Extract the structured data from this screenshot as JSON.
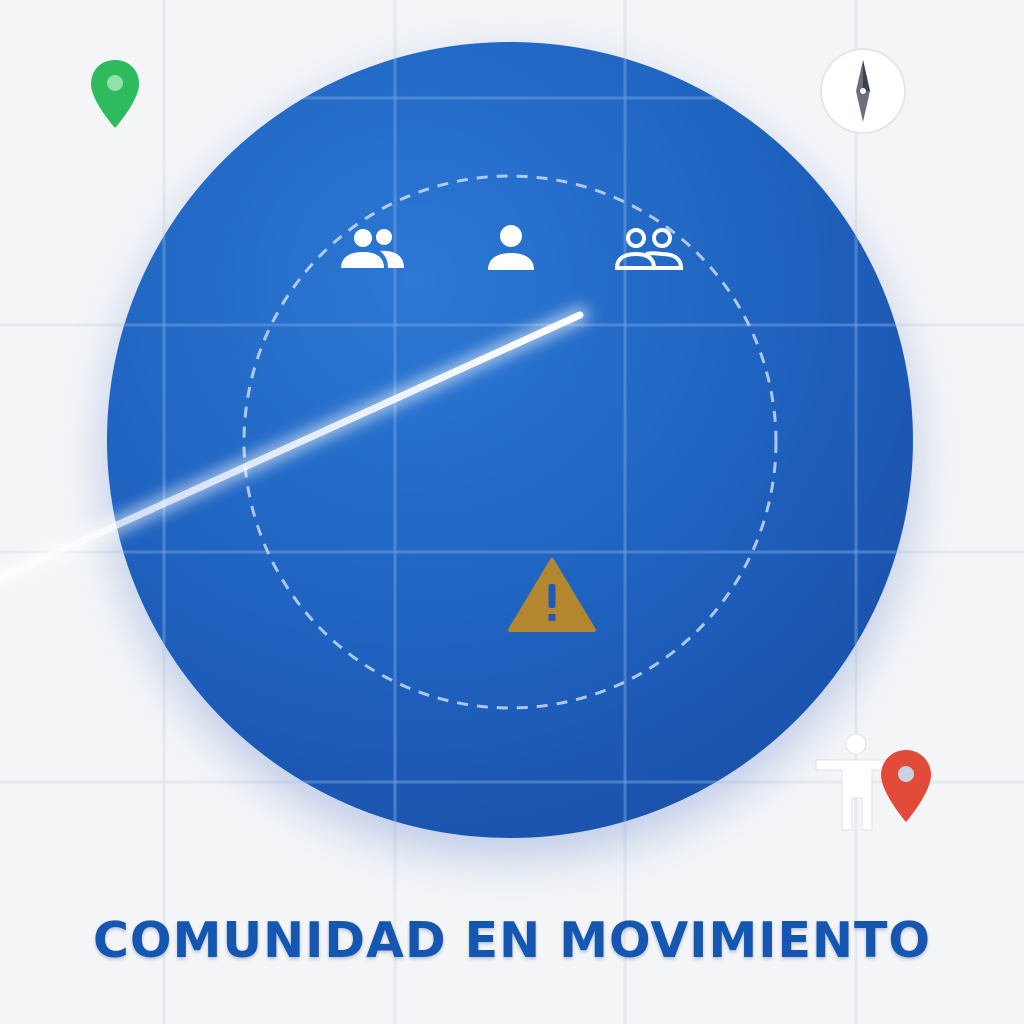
{
  "title": "COMUNIDAD EN MOVIMIENTO",
  "icons": {
    "group_filled": "group-icon",
    "person": "person-icon",
    "group_outline": "group-outline-icon",
    "warning": "warning-icon",
    "map_pin_green": "map-pin-icon",
    "map_pin_red": "map-pin-icon",
    "compass": "compass-icon",
    "pedestrian": "pedestrian-icon"
  },
  "colors": {
    "globe": "#1f66c4",
    "title": "#1556b0",
    "warning": "#b3862f",
    "pin_green": "#2dbb5d",
    "pin_red": "#e24b3a",
    "background": "#f4f5f7"
  }
}
